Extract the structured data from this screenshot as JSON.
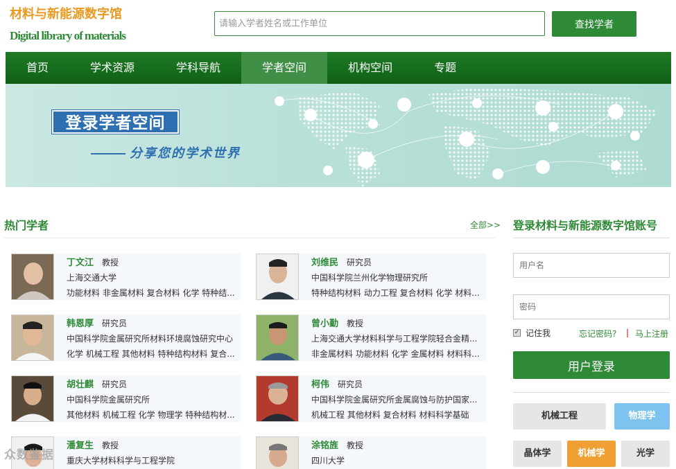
{
  "header": {
    "logo_cn": "材料与新能源数字馆",
    "logo_en": "Digital library of materials",
    "search_placeholder": "请输入学者姓名或工作单位",
    "search_button": "查找学者"
  },
  "nav": {
    "items": [
      "首页",
      "学术资源",
      "学科导航",
      "学者空间",
      "机构空间",
      "专题"
    ],
    "active_index": 3
  },
  "banner": {
    "title": "登录学者空间",
    "subtitle": "分享您的学术世界"
  },
  "hot": {
    "title": "热门学者",
    "all_link": "全部>>"
  },
  "scholars": [
    {
      "name": "丁文江",
      "title": "教授",
      "org": "上海交通大学",
      "fields": "功能材料 非金属材料 复合材料 化学 特种结..."
    },
    {
      "name": "刘维民",
      "title": "研究员",
      "org": "中国科学院兰州化学物理研究所",
      "fields": "特种结构材料 动力工程 复合材料 化学 材料..."
    },
    {
      "name": "韩恩厚",
      "title": "研究员",
      "org": "中国科学院金属研究所材料环境腐蚀研究中心",
      "fields": "化学 机械工程 其他材料 特种结构材料 复合..."
    },
    {
      "name": "曾小勤",
      "title": "教授",
      "org": "上海交通大学材料科学与工程学院轻合金精...",
      "fields": "非金属材料 功能材料 化学 金属材料 材料科..."
    },
    {
      "name": "胡壮麒",
      "title": "研究员",
      "org": "中国科学院金属研究所",
      "fields": "其他材料 机械工程 化学 物理学 特种结构材..."
    },
    {
      "name": "柯伟",
      "title": "研究员",
      "org": "中国科学院金属研究所金属腐蚀与防护国家...",
      "fields": "机械工程 其他材料 复合材料 材料科学基础"
    },
    {
      "name": "潘复生",
      "title": "教授",
      "org": "重庆大学材料科学与工程学院",
      "fields": ""
    },
    {
      "name": "涂铭旌",
      "title": "教授",
      "org": "四川大学",
      "fields": ""
    }
  ],
  "login": {
    "title": "登录材料与新能源数字馆账号",
    "username_placeholder": "用户名",
    "password_placeholder": "密码",
    "remember": "记住我",
    "forgot": "忘记密码?",
    "separator": "|",
    "register": "马上注册",
    "button": "用户登录"
  },
  "tags": [
    {
      "label": "机械工程",
      "bg": "#e6e6e6",
      "fg": "#333333"
    },
    {
      "label": "物理学",
      "bg": "#7ec3f0",
      "fg": "#ffffff"
    },
    {
      "label": "晶体学",
      "bg": "#e6e6e6",
      "fg": "#333333"
    },
    {
      "label": "机械学",
      "bg": "#f0a033",
      "fg": "#ffffff"
    },
    {
      "label": "光学",
      "bg": "#e6e6e6",
      "fg": "#333333"
    }
  ],
  "watermark": "众数鉴据",
  "colors": {
    "brand_green": "#2e8a36",
    "logo_orange": "#e89a22",
    "banner_blue": "#2d6fb0"
  }
}
